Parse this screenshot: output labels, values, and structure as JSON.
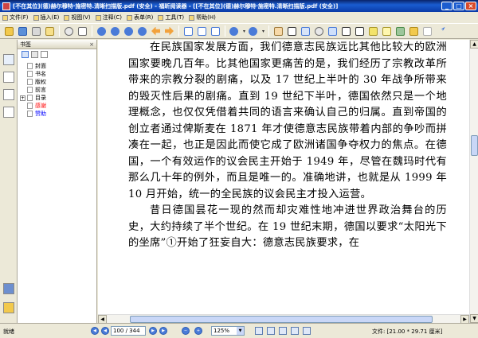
{
  "window": {
    "title": "[不在其位](德)赫尔穆特·施密特.清晰扫描版.pdf (安全) - 福昕阅读器 - [[不在其位](德)赫尔穆特·施密特.清晰扫描版.pdf (安全)]"
  },
  "menu": [
    {
      "label": "文件(F)"
    },
    {
      "label": "视图(V)"
    },
    {
      "label": "注释(C)"
    },
    {
      "label": "表单(R)"
    },
    {
      "label": "工具(T)"
    },
    {
      "label": "帮助(H)"
    }
  ],
  "menu_insert": "插入(E)",
  "bookmarks": {
    "header": "书签",
    "close": "×",
    "items": [
      {
        "label": "封面",
        "color": "#000000"
      },
      {
        "label": "书名",
        "color": "#000000"
      },
      {
        "label": "版权",
        "color": "#000000"
      },
      {
        "label": "前言",
        "color": "#000000"
      },
      {
        "label": "目录",
        "color": "#000000",
        "expander": "+"
      },
      {
        "label": "感谢",
        "color": "#ff0000"
      },
      {
        "label": "赞助",
        "color": "#0000ff"
      }
    ]
  },
  "document": {
    "paragraph1": "在民族国家发展方面，我们德意志民族远比其他比较大的欧洲国家要晚几百年。比其他国家更痛苦的是，我们经历了宗教改革所带来的宗教分裂的剧痛，以及 17 世纪上半叶的 30 年战争所带来的毁灭性后果的剧痛。直到 19 世纪下半叶，德国依然只是一个地理概念，也仅仅凭借着共同的语言来确认自己的归属。直到帝国的创立者通过俾斯麦在 1871 年才使德意志民族带着内部的争吵而拼凑在一起，也正是因此而使它成了欧洲诸国争夺权力的焦点。在德国，一个有效运作的议会民主开始于 1949 年，尽管在魏玛时代有那么几十年的例外，而且是唯一的。准确地讲，也就是从 1999 年 10 月开始，统一的全民族的议会民主才投入运营。",
    "paragraph2": "昔日德国昙花一现的然而却灾难性地冲进世界政治舞台的历史，大约持续了半个世纪。在 19 世纪末期，德国以要求“太阳光下的坐席”①开始了狂妄自大：德意志民族要求，在"
  },
  "status": {
    "left_text": "就绪",
    "page_current": "100 / 344",
    "zoom": "125%",
    "file_size": "文件: [21.00 * 29.71 厘米]"
  },
  "colors": {
    "titlebar": "#0a246a",
    "chrome": "#ece9d8",
    "bookmark_red": "#ff0000",
    "bookmark_blue": "#0000ff"
  }
}
